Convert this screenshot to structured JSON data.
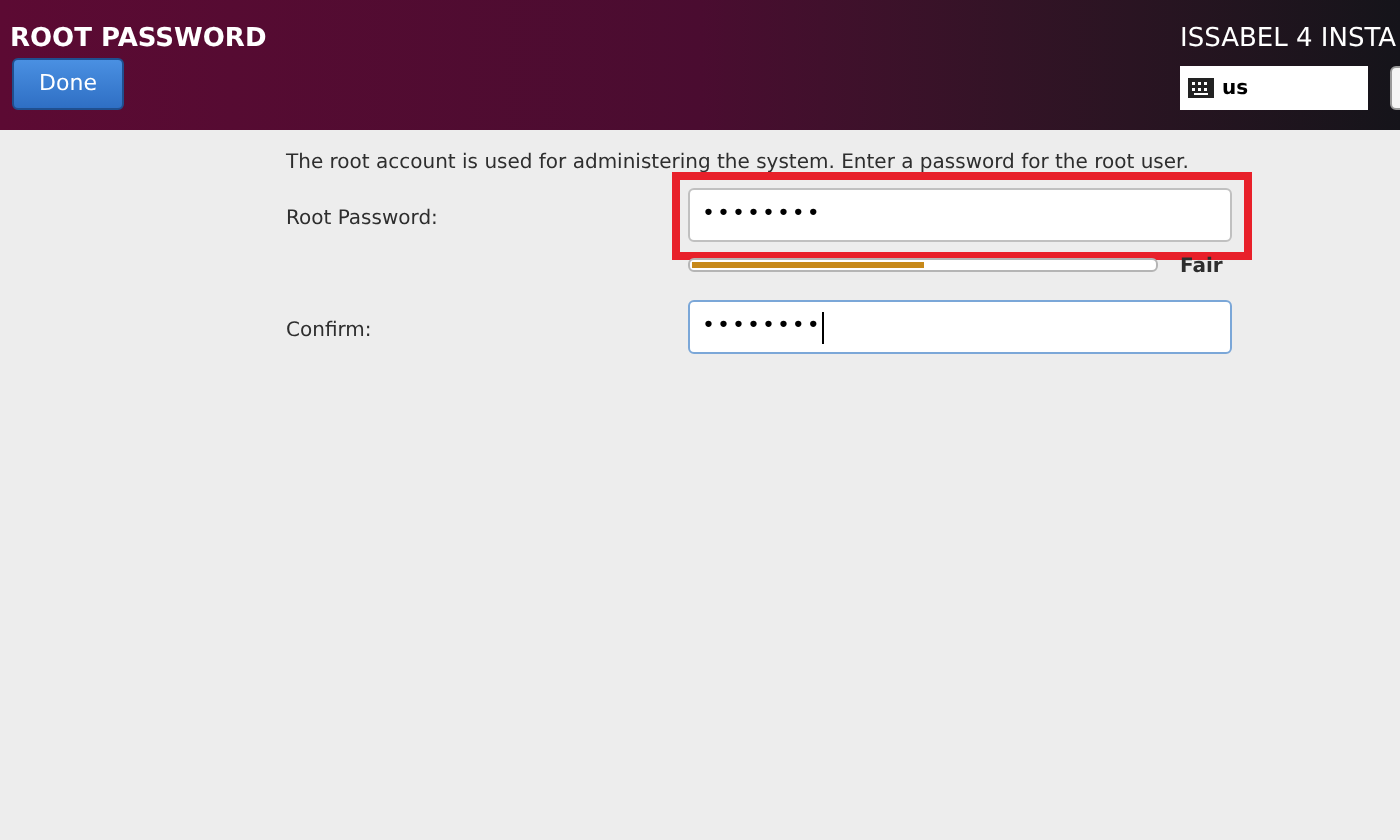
{
  "header": {
    "title": "ROOT PASSWORD",
    "done_button": "Done",
    "product_title": "ISSABEL 4 INSTA",
    "keyboard_layout": "us"
  },
  "intro": "The root account is used for administering the system.  Enter a password for the root user.",
  "fields": [
    {
      "label": "Root Password:",
      "value": "••••••••",
      "focused": false,
      "highlighted": true
    },
    {
      "label": "Confirm:",
      "value": "••••••••",
      "focused": true,
      "highlighted": false
    }
  ],
  "strength": {
    "level": 0.5,
    "reading": "Fair"
  }
}
